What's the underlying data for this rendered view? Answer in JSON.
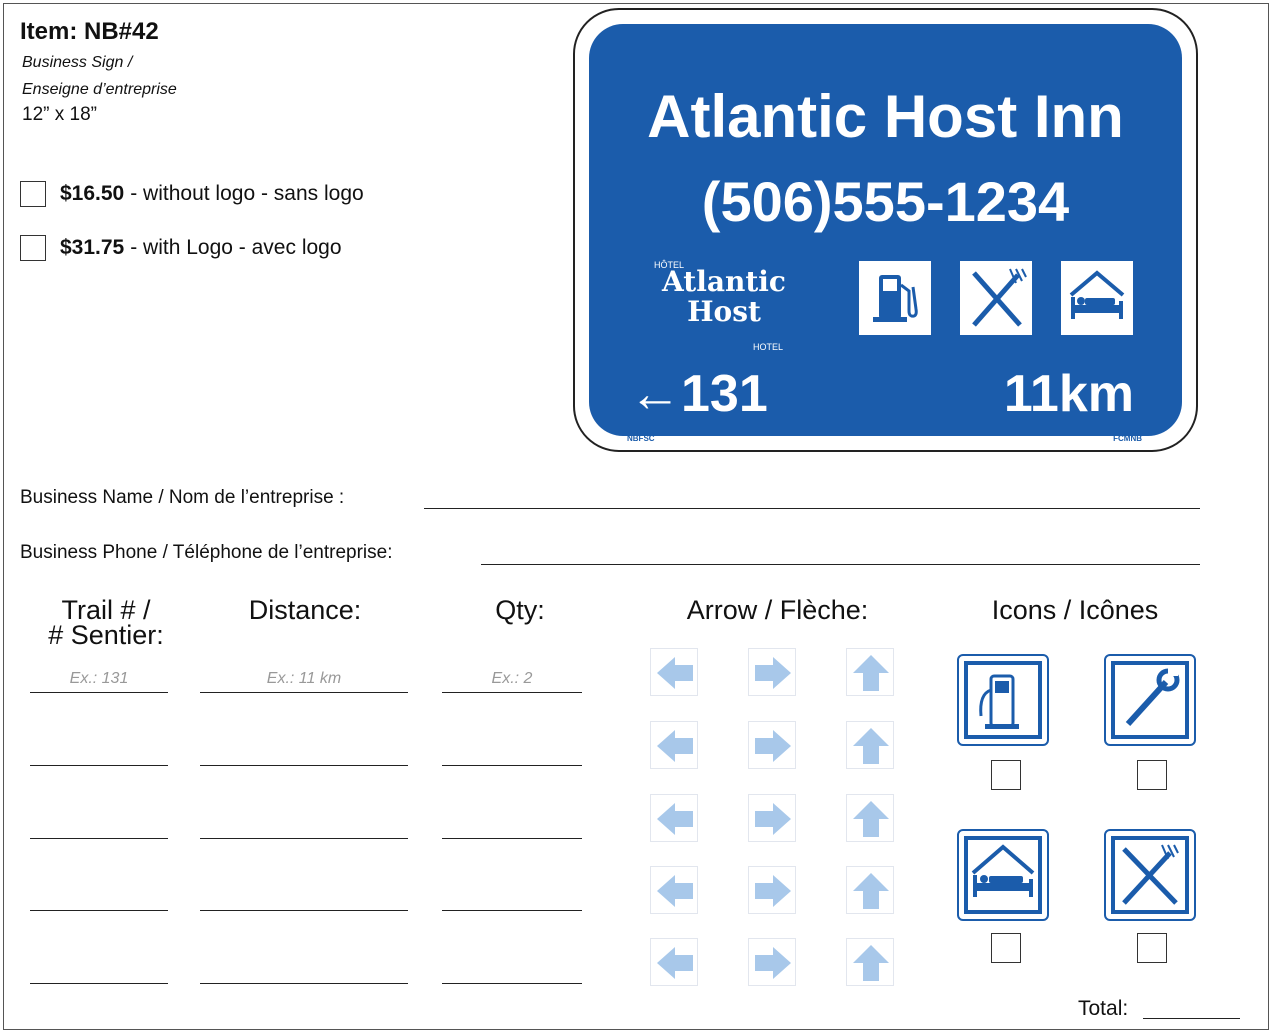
{
  "header": {
    "item_title": "Item: NB#42",
    "subtitle_line1": "Business Sign /",
    "subtitle_line2": "Enseigne d’entreprise",
    "size": "12” x 18”"
  },
  "options": [
    {
      "price": "$16.50",
      "desc": " - without logo - sans logo"
    },
    {
      "price": "$31.75",
      "desc": " - with Logo - avec logo"
    }
  ],
  "sign": {
    "name": "Atlantic Host Inn",
    "phone": "(506)555-1234",
    "logo_top": "HÔTEL",
    "logo_line1": "Atlantic",
    "logo_line2": "Host",
    "logo_bottom": "HOTEL",
    "route": "131",
    "distance": "11km",
    "left_tiny": "NBFSC",
    "right_tiny": "FCMNB",
    "icons": [
      "fuel-icon",
      "restaurant-icon",
      "lodging-icon"
    ],
    "color": "#1b5cab"
  },
  "form": {
    "business_name_label": "Business Name / Nom de l’entreprise :",
    "business_phone_label": "Business Phone / Téléphone de l’entreprise:"
  },
  "columns": {
    "trail_line1": "Trail # /",
    "trail_line2": "# Sentier:",
    "distance": "Distance:",
    "qty": "Qty:",
    "arrow": "Arrow / Flèche:",
    "icons": "Icons / Icônes"
  },
  "examples": {
    "trail": "Ex.: 131",
    "distance": "Ex.: 11 km",
    "qty": "Ex.: 2"
  },
  "arrow_options": [
    "left-arrow-icon",
    "right-arrow-icon",
    "up-arrow-icon"
  ],
  "icon_options": [
    "fuel-icon",
    "wrench-icon",
    "lodging-icon",
    "restaurant-icon"
  ],
  "total_label": "Total:"
}
